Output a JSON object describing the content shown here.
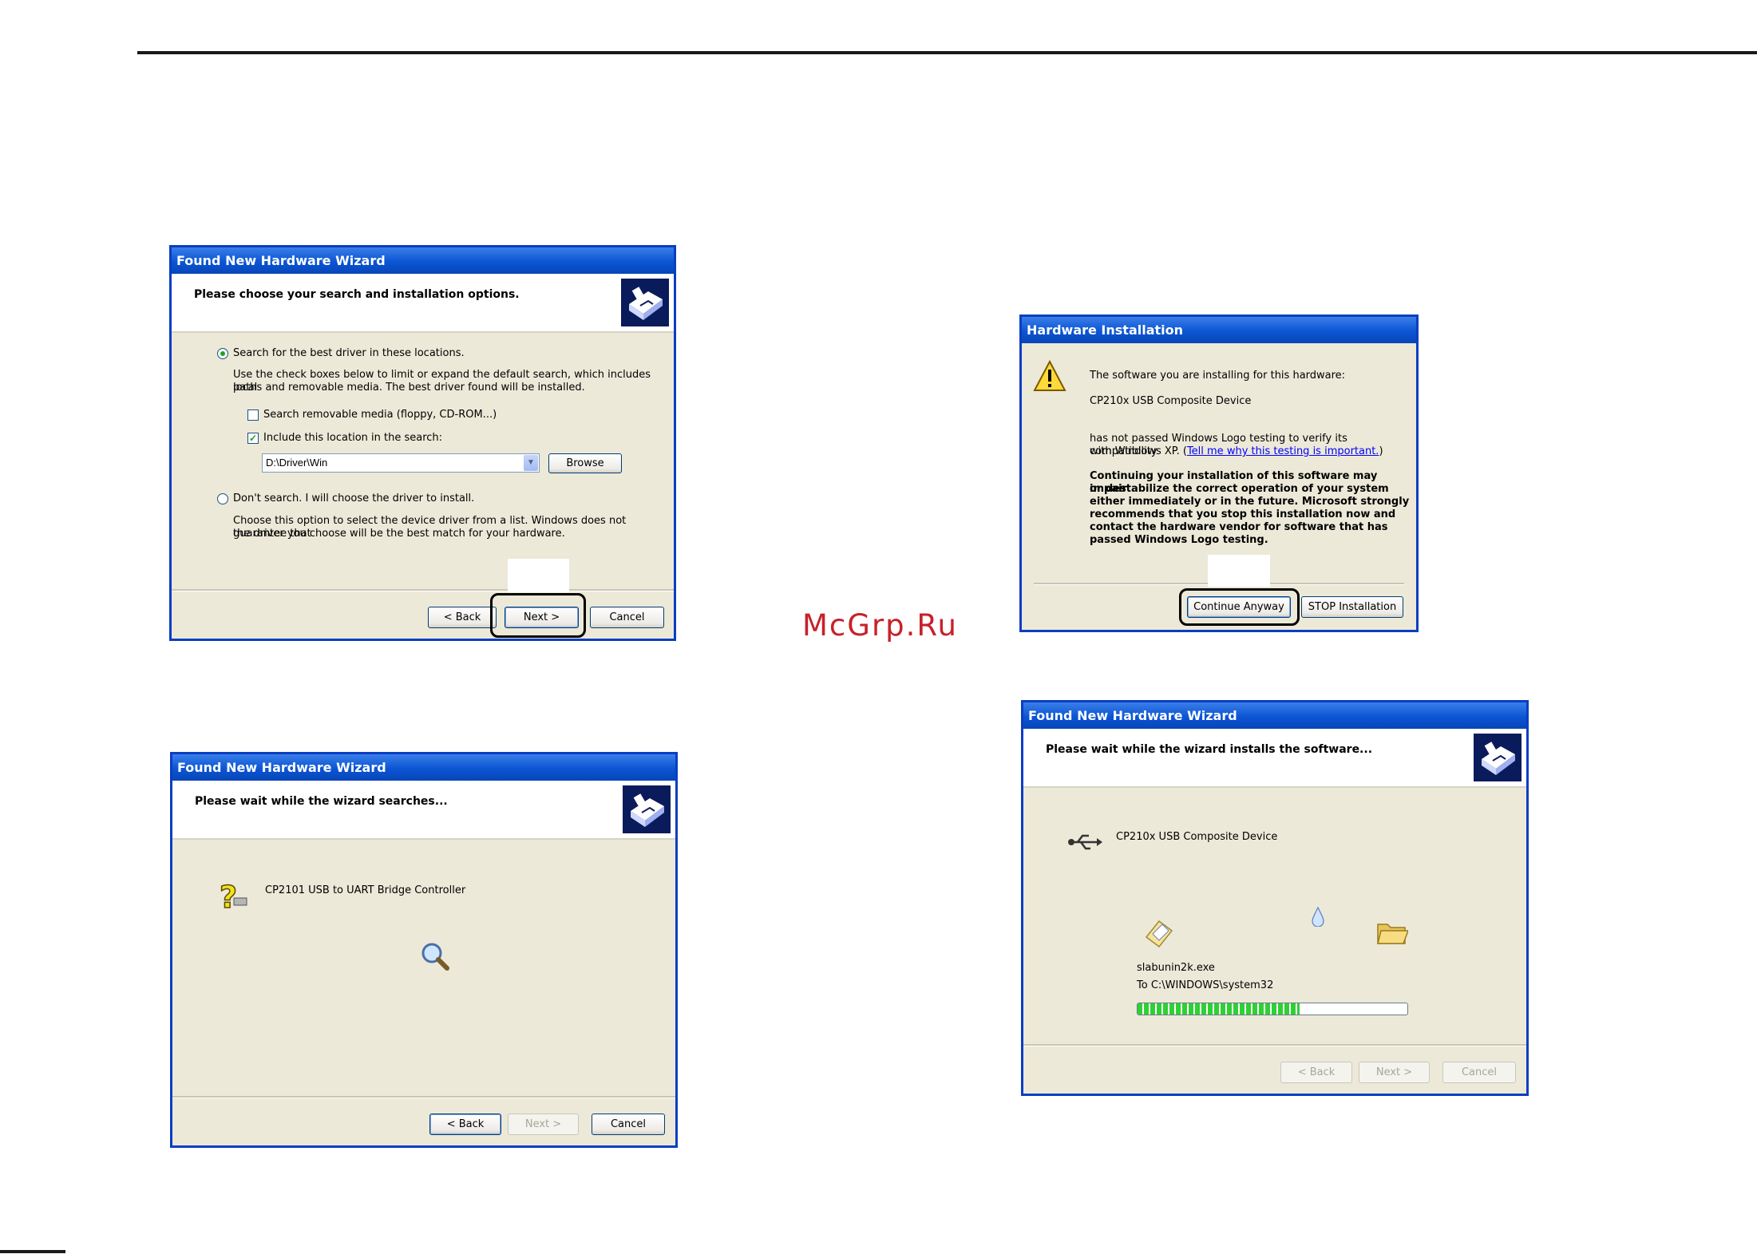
{
  "watermark": "McGrp.Ru",
  "dialog1": {
    "title": "Found New Hardware Wizard",
    "header": "Please choose your search and installation options.",
    "option_search": "Search for the best driver in these locations.",
    "search_desc_1": "Use the check boxes below to limit or expand the default search, which includes local",
    "search_desc_2": "paths and removable media. The best driver found will be installed.",
    "check_removable": "Search removable media (floppy, CD-ROM...)",
    "check_removable_checked": false,
    "check_location": "Include this location in the search:",
    "check_location_checked": true,
    "location_value": "D:\\Driver\\Win",
    "browse": "Browse",
    "option_dont_search": "Don't search. I will choose the driver to install.",
    "dont_desc_1": "Choose this option to select the device driver from a list.  Windows does not guarantee that",
    "dont_desc_2": "the driver you choose will be the best match for your hardware.",
    "back": "< Back",
    "next": "Next >",
    "cancel": "Cancel"
  },
  "dialog2": {
    "title": "Found New Hardware Wizard",
    "header": "Please wait while the wizard searches...",
    "device": "CP2101 USB to UART Bridge Controller",
    "back": "< Back",
    "next": "Next >",
    "cancel": "Cancel"
  },
  "dialog3": {
    "title": "Hardware Installation",
    "line1": "The software you are installing for this hardware:",
    "device": "CP210x USB Composite Device",
    "line2a": "has not passed Windows Logo testing to verify its compatibility",
    "line2b_prefix": "with Windows XP. (",
    "link": "Tell me why this testing is important.",
    "line2b_suffix": ")",
    "warn1": "Continuing your installation of this software may impair",
    "warn2": "or destabilize the correct operation of your system",
    "warn3": "either immediately or in the future. Microsoft strongly",
    "warn4": "recommends that you stop this installation now and",
    "warn5": "contact the hardware vendor for software that has",
    "warn6": "passed Windows Logo testing.",
    "continue": "Continue Anyway",
    "stop": "STOP Installation"
  },
  "dialog4": {
    "title": "Found New Hardware Wizard",
    "header": "Please wait while the wizard installs the software...",
    "device": "CP210x USB Composite Device",
    "file": "slabunin2k.exe",
    "dest": "To C:\\WINDOWS\\system32",
    "progress": 0.6,
    "back": "< Back",
    "next": "Next >",
    "cancel": "Cancel"
  },
  "icons": [
    "wizard-hardware-icon",
    "question-mark-icon",
    "search-magnifier-icon",
    "warning-icon",
    "usb-icon",
    "document-icon",
    "water-drop-icon",
    "folder-icon"
  ],
  "colors": {
    "title_bar": "#0b55d4",
    "dialog_bg": "#ece9d8",
    "watermark": "#c8202a",
    "progress": "#2fd033"
  }
}
